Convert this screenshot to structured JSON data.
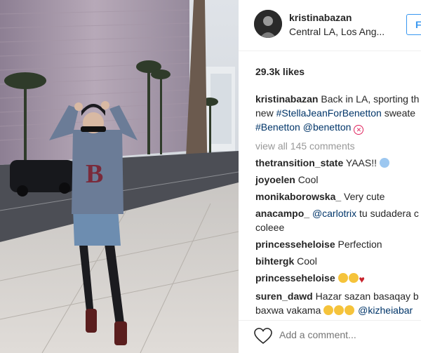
{
  "post": {
    "username": "kristinabazan",
    "location": "Central LA, Los Ang...",
    "follow_label": "F",
    "likes": "29.3k likes",
    "caption": {
      "user": "kristinabazan",
      "text_1": "Back in LA, sporting th",
      "text_2": "new",
      "tag_1": "#StellaJeanForBenetton",
      "text_3": "sweate",
      "tag_2": "#Benetton",
      "tag_3": "@benetton"
    },
    "view_all": "view all 145 comments",
    "comments": [
      {
        "user": "thetransition_state",
        "text": "YAAS!!"
      },
      {
        "user": "joyoelen",
        "text": "Cool"
      },
      {
        "user": "monikaborowska_",
        "text": "Very cute"
      },
      {
        "user": "anacampo_",
        "tag": "@carlotrix",
        "text": "tu sudadera c",
        "text2": "coleee"
      },
      {
        "user": "princesseheloise",
        "text": "Perfection"
      },
      {
        "user": "bihtergk",
        "text": "Cool"
      },
      {
        "user": "princesseheloise",
        "text": ""
      },
      {
        "user": "suren_dawd",
        "text": "Hazar sazan basaqay b",
        "text2": "baxwa vakama",
        "tag": "@kizheiabar"
      }
    ],
    "add_comment_placeholder": "Add a comment..."
  },
  "icons": [
    "heart-icon",
    "avatar"
  ],
  "colors": {
    "link": "#003569",
    "follow": "#3897f0",
    "muted": "#999999"
  }
}
